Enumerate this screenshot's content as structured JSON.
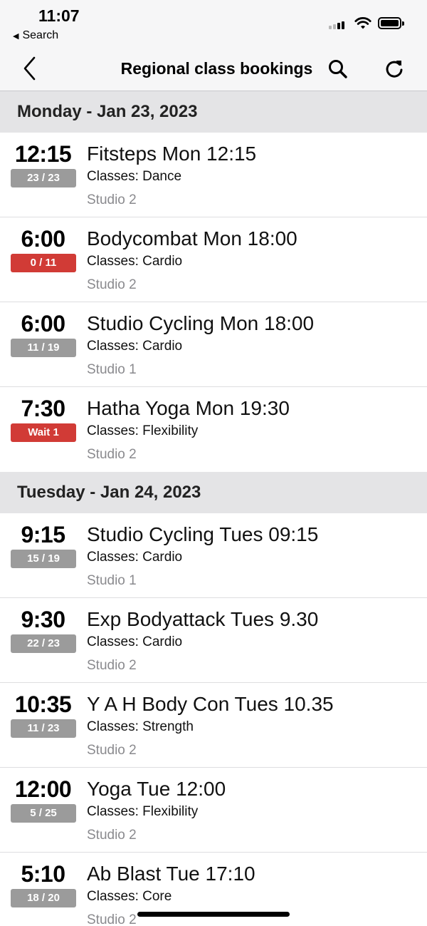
{
  "status_bar": {
    "time": "11:07",
    "back_app_label": "Search",
    "icons": [
      "signal-icon",
      "wifi-icon",
      "battery-icon"
    ]
  },
  "nav": {
    "title": "Regional class bookings",
    "icons": [
      "chevron-left-icon",
      "search-icon",
      "refresh-icon"
    ]
  },
  "colors": {
    "badge_available": "#9b9b9b",
    "badge_full": "#d13b36",
    "section_header_bg": "#e4e4e6",
    "secondary_text": "#8a8a8e"
  },
  "days": [
    {
      "label": "Monday - Jan 23, 2023",
      "classes": [
        {
          "time": "12:15",
          "badge": "23 / 23",
          "badge_status": "available",
          "name": "Fitsteps Mon 12:15",
          "type": "Classes: Dance",
          "studio": "Studio 2"
        },
        {
          "time": "6:00",
          "badge": "0 / 11",
          "badge_status": "full",
          "name": "Bodycombat Mon 18:00",
          "type": "Classes: Cardio",
          "studio": "Studio 2"
        },
        {
          "time": "6:00",
          "badge": "11 / 19",
          "badge_status": "available",
          "name": "Studio Cycling Mon 18:00",
          "type": "Classes: Cardio",
          "studio": "Studio 1"
        },
        {
          "time": "7:30",
          "badge": "Wait 1",
          "badge_status": "full",
          "name": "Hatha Yoga Mon 19:30",
          "type": "Classes: Flexibility",
          "studio": "Studio 2"
        }
      ]
    },
    {
      "label": "Tuesday - Jan 24, 2023",
      "classes": [
        {
          "time": "9:15",
          "badge": "15 / 19",
          "badge_status": "available",
          "name": "Studio Cycling Tues 09:15",
          "type": "Classes: Cardio",
          "studio": "Studio 1"
        },
        {
          "time": "9:30",
          "badge": "22 / 23",
          "badge_status": "available",
          "name": "Exp Bodyattack Tues 9.30",
          "type": "Classes: Cardio",
          "studio": "Studio 2"
        },
        {
          "time": "10:35",
          "badge": "11 / 23",
          "badge_status": "available",
          "name": "Y A H Body Con Tues 10.35",
          "type": "Classes: Strength",
          "studio": "Studio 2"
        },
        {
          "time": "12:00",
          "badge": "5 / 25",
          "badge_status": "available",
          "name": "Yoga Tue 12:00",
          "type": "Classes: Flexibility",
          "studio": "Studio 2"
        },
        {
          "time": "5:10",
          "badge": "18 / 20",
          "badge_status": "available",
          "name": "Ab Blast Tue 17:10",
          "type": "Classes: Core",
          "studio": "Studio 2"
        }
      ]
    }
  ]
}
